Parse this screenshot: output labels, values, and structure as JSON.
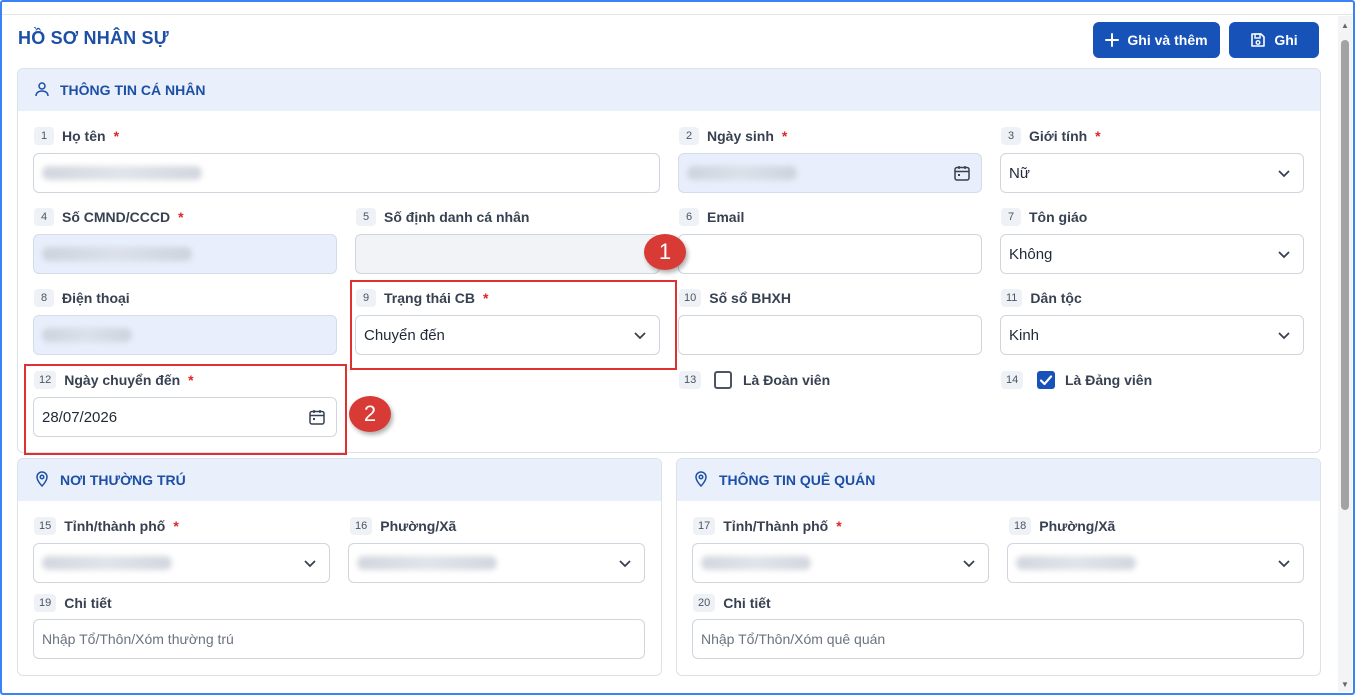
{
  "page": {
    "title": "HỒ SƠ NHÂN SỰ",
    "btn_add_label": "Ghi và thêm",
    "btn_save_label": "Ghi"
  },
  "colors": {
    "primary": "#1652b8",
    "title": "#1d4fa6",
    "header_bg": "#e9f0fb",
    "required": "#dc2626",
    "highlight": "#e0302f"
  },
  "personal": {
    "section_title": "THÔNG TIN CÁ NHÂN",
    "icon": "user-icon",
    "fields": {
      "ho_ten": {
        "num": "1",
        "label": "Họ tên",
        "req": "*"
      },
      "ngay_sinh": {
        "num": "2",
        "label": "Ngày sinh",
        "req": "*"
      },
      "gioi_tinh": {
        "num": "3",
        "label": "Giới tính",
        "req": "*",
        "value": "Nữ"
      },
      "cmnd": {
        "num": "4",
        "label": "Số CMND/CCCD",
        "req": "*"
      },
      "dinh_danh": {
        "num": "5",
        "label": "Số định danh cá nhân"
      },
      "email": {
        "num": "6",
        "label": "Email"
      },
      "ton_giao": {
        "num": "7",
        "label": "Tôn giáo",
        "value": "Không"
      },
      "dien_thoai": {
        "num": "8",
        "label": "Điện thoại"
      },
      "trang_thai": {
        "num": "9",
        "label": "Trạng thái CB",
        "req": "*",
        "value": "Chuyển đến"
      },
      "bhxh": {
        "num": "10",
        "label": "Số sổ BHXH"
      },
      "dan_toc": {
        "num": "11",
        "label": "Dân tộc",
        "value": "Kinh"
      },
      "ngay_chuyen_den": {
        "num": "12",
        "label": "Ngày chuyển đến",
        "req": "*",
        "value": "28/07/2026"
      },
      "doan_vien": {
        "num": "13",
        "label": "Là Đoàn viên",
        "checked": false
      },
      "dang_vien": {
        "num": "14",
        "label": "Là Đảng viên",
        "checked": true
      }
    }
  },
  "permanent": {
    "section_title": "NƠI THƯỜNG TRÚ",
    "icon": "location-pin-icon",
    "tinh": {
      "num": "15",
      "label": "Tỉnh/thành phố",
      "req": "*"
    },
    "phuong": {
      "num": "16",
      "label": "Phường/Xã"
    },
    "chi_tiet": {
      "num": "19",
      "label": "Chi tiết",
      "placeholder": "Nhập Tổ/Thôn/Xóm thường trú"
    }
  },
  "hometown": {
    "section_title": "THÔNG TIN QUÊ QUÁN",
    "icon": "location-pin-icon",
    "tinh": {
      "num": "17",
      "label": "Tỉnh/Thành phố",
      "req": "*"
    },
    "phuong": {
      "num": "18",
      "label": "Phường/Xã"
    },
    "chi_tiet": {
      "num": "20",
      "label": "Chi tiết",
      "placeholder": "Nhập Tổ/Thôn/Xóm quê quán"
    }
  },
  "annotations": {
    "marker_1": "1",
    "marker_2": "2"
  }
}
